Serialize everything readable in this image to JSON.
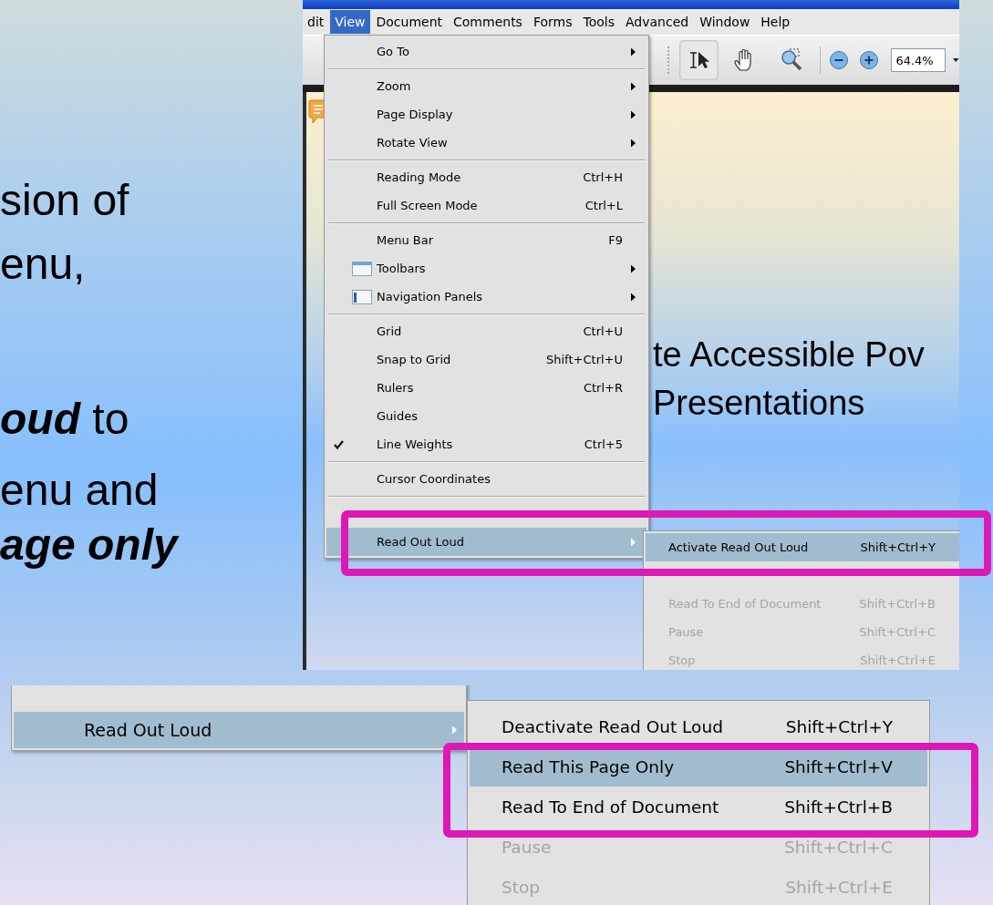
{
  "slide_lines": [
    {
      "text": "sion of",
      "emphasis": false
    },
    {
      "text": "enu,",
      "emphasis": false
    },
    {
      "text": "**oud** to",
      "emphasis": false
    },
    {
      "text": "enu and",
      "emphasis": false
    },
    {
      "text": "age only",
      "emphasis": true
    }
  ],
  "screenshot_1": {
    "menu_bar": [
      {
        "label": "dit",
        "selected": false
      },
      {
        "label": "View",
        "selected": true
      },
      {
        "label": "Document",
        "selected": false
      },
      {
        "label": "Comments",
        "selected": false
      },
      {
        "label": "Forms",
        "selected": false
      },
      {
        "label": "Tools",
        "selected": false
      },
      {
        "label": "Advanced",
        "selected": false
      },
      {
        "label": "Window",
        "selected": false
      },
      {
        "label": "Help",
        "selected": false
      }
    ],
    "toolbar": [
      {
        "kind": "select",
        "selected": true
      },
      {
        "kind": "hand",
        "selected": false
      },
      {
        "kind": "marquee-zoom",
        "selected": false
      },
      {
        "kind": "divider"
      },
      {
        "kind": "zoom-out",
        "selected": false
      },
      {
        "kind": "zoom-in",
        "selected": false
      }
    ],
    "zoom_field": {
      "value": "64.4%"
    },
    "document_title": [
      "te Accessible Pov",
      "Presentations"
    ],
    "view_menu": [
      {
        "kind": "item",
        "label": "Go To",
        "submenu": true,
        "checked": false,
        "disabled": false,
        "selected": false
      },
      {
        "kind": "separator"
      },
      {
        "kind": "item",
        "label": "Zoom",
        "submenu": true,
        "checked": false,
        "disabled": false,
        "selected": false
      },
      {
        "kind": "item",
        "label": "Page Display",
        "submenu": true,
        "checked": false,
        "disabled": false,
        "selected": false
      },
      {
        "kind": "item",
        "label": "Rotate View",
        "submenu": true,
        "checked": false,
        "disabled": false,
        "selected": false
      },
      {
        "kind": "separator"
      },
      {
        "kind": "item",
        "label": "Reading Mode",
        "shortcut": "Ctrl+H",
        "submenu": false,
        "checked": false,
        "disabled": false,
        "selected": false
      },
      {
        "kind": "item",
        "label": "Full Screen Mode",
        "shortcut": "Ctrl+L",
        "submenu": false,
        "checked": false,
        "disabled": false,
        "selected": false
      },
      {
        "kind": "separator"
      },
      {
        "kind": "item",
        "label": "Menu Bar",
        "shortcut": "F9",
        "submenu": false,
        "checked": false,
        "disabled": false,
        "selected": false
      },
      {
        "kind": "item",
        "label": "Toolbars",
        "submenu": true,
        "checked": false,
        "disabled": false,
        "selected": false
      },
      {
        "kind": "item",
        "label": "Navigation Panels",
        "submenu": true,
        "checked": false,
        "disabled": false,
        "selected": false
      },
      {
        "kind": "separator"
      },
      {
        "kind": "item",
        "label": "Grid",
        "shortcut": "Ctrl+U",
        "submenu": false,
        "checked": false,
        "disabled": false,
        "selected": false
      },
      {
        "kind": "item",
        "label": "Snap to Grid",
        "shortcut": "Shift+Ctrl+U",
        "submenu": false,
        "checked": false,
        "disabled": false,
        "selected": false
      },
      {
        "kind": "item",
        "label": "Rulers",
        "shortcut": "Ctrl+R",
        "submenu": false,
        "checked": false,
        "disabled": false,
        "selected": false
      },
      {
        "kind": "item",
        "label": "Guides",
        "submenu": false,
        "checked": false,
        "disabled": false,
        "selected": false
      },
      {
        "kind": "item",
        "label": "Line Weights",
        "shortcut": "Ctrl+5",
        "submenu": false,
        "checked": true,
        "disabled": false,
        "selected": false
      },
      {
        "kind": "separator"
      },
      {
        "kind": "item",
        "label": "Cursor Coordinates",
        "submenu": false,
        "checked": false,
        "disabled": false,
        "selected": false
      },
      {
        "kind": "separator"
      },
      {
        "kind": "blank"
      },
      {
        "kind": "item",
        "label": "Read Out Loud",
        "submenu": true,
        "checked": false,
        "disabled": false,
        "selected": true
      }
    ],
    "read_out_loud_submenu": [
      {
        "kind": "item",
        "label": "Activate Read Out Loud",
        "shortcut": "Shift+Ctrl+Y",
        "disabled": false,
        "selected": true
      },
      {
        "kind": "blank"
      },
      {
        "kind": "item",
        "label": "Read To End of Document",
        "shortcut": "Shift+Ctrl+B",
        "disabled": true,
        "selected": false
      },
      {
        "kind": "item",
        "label": "Pause",
        "shortcut": "Shift+Ctrl+C",
        "disabled": true,
        "selected": false
      },
      {
        "kind": "item",
        "label": "Stop",
        "shortcut": "Shift+Ctrl+E",
        "disabled": true,
        "selected": false
      }
    ]
  },
  "screenshot_2": {
    "view_menu": [
      {
        "kind": "blank"
      },
      {
        "kind": "item",
        "label": "Read Out Loud",
        "submenu": true,
        "disabled": false,
        "selected": true
      }
    ],
    "read_out_loud_submenu": [
      {
        "kind": "item",
        "label": "Deactivate Read Out Loud",
        "shortcut": "Shift+Ctrl+Y",
        "disabled": false,
        "selected": false
      },
      {
        "kind": "item",
        "label": "Read This Page Only",
        "shortcut": "Shift+Ctrl+V",
        "disabled": false,
        "selected": true
      },
      {
        "kind": "item",
        "label": "Read To End of Document",
        "shortcut": "Shift+Ctrl+B",
        "disabled": false,
        "selected": false
      },
      {
        "kind": "item",
        "label": "Pause",
        "shortcut": "Shift+Ctrl+C",
        "disabled": true,
        "selected": false
      },
      {
        "kind": "item",
        "label": "Stop",
        "shortcut": "Shift+Ctrl+E",
        "disabled": true,
        "selected": false
      }
    ]
  }
}
